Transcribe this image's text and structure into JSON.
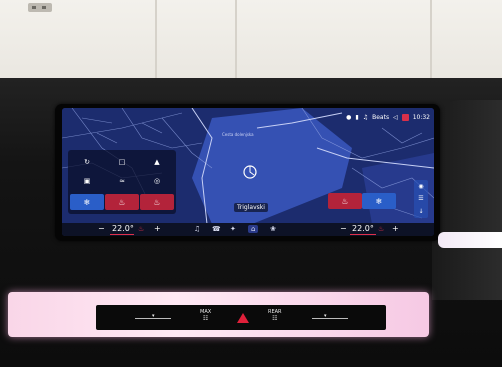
{
  "map": {
    "destination_label": "Triglavski",
    "street_label": "Cesta dolenjska"
  },
  "status_bar": {
    "media_label": "Beats",
    "time": "10:32"
  },
  "climate": {
    "driver_temp": "22.0°",
    "passenger_temp": "22.0°",
    "minus_label": "−",
    "plus_label": "+"
  },
  "dock_icons": [
    "music-icon",
    "phone-icon",
    "apps-icon",
    "home-icon",
    "fan-icon"
  ],
  "lower_controls": {
    "max_label": "MAX",
    "rear_label": "REAR"
  },
  "colors": {
    "map_bg": "#1a2a66",
    "accent_red": "#e0304c",
    "accent_blue": "#2a5ec8"
  }
}
